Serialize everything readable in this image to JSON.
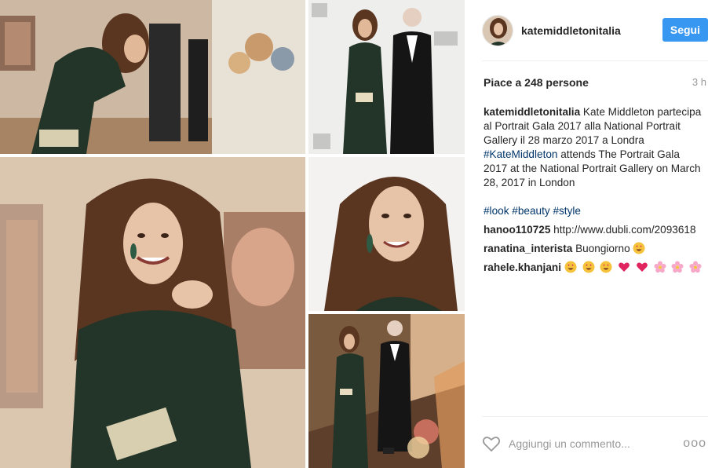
{
  "post": {
    "username": "katemiddletonitalia",
    "follow_label": "Segui",
    "likes_text": "Piace a 248 persone",
    "time_ago": "3 h",
    "caption": {
      "username": "katemiddletonitalia",
      "text_1": "Kate Middleton partecipa al Portrait Gala 2017 alla National Portrait Gallery il 28 marzo 2017 a Londra",
      "hashtag_1": "#KateMiddleton",
      "text_2": "attends The Portrait Gala 2017 at the National Portrait Gallery on March 28, 2017 in London",
      "hashtags": [
        "#look",
        "#beauty",
        "#style"
      ]
    },
    "comments": [
      {
        "username": "hanoo110725",
        "text": "http://www.dubli.com/2093618"
      },
      {
        "username": "ranatina_interista",
        "text": "Buongiorno",
        "emojis": [
          "heart-eyes"
        ]
      },
      {
        "username": "rahele.khanjani",
        "text": "",
        "emojis": [
          "heart-eyes",
          "heart-eyes",
          "heart-eyes",
          "red-heart",
          "red-heart",
          "blossom",
          "blossom",
          "blossom"
        ]
      }
    ],
    "add_comment_placeholder": "Aggiungi un commento...",
    "more_label": "ooo"
  },
  "photos": {
    "icons": [
      "photo-gallery-lean",
      "photo-red-carpet",
      "photo-smile-closeup",
      "photo-portrait",
      "photo-staircase"
    ],
    "palette": {
      "lace_green": "#233528",
      "skin": "#e7c3a8",
      "hair": "#5a3520",
      "wall": "#d9c7b4"
    }
  },
  "colors": {
    "accent": "#3897f0",
    "hashtag": "#003569",
    "muted": "#999999"
  }
}
